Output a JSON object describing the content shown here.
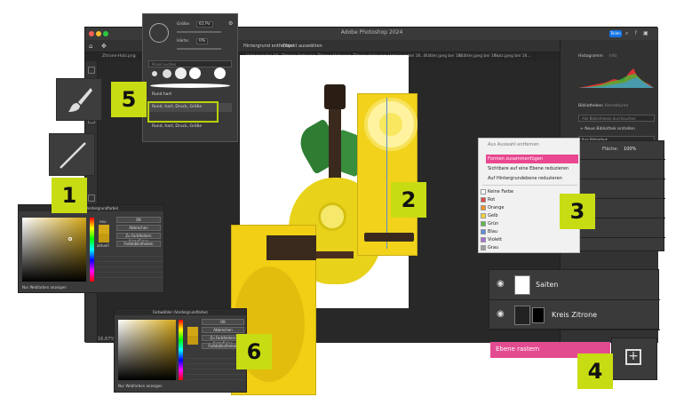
{
  "window": {
    "title": "Adobe Photoshop 2024",
    "share_label": "Teilen",
    "zoom": "16,67%"
  },
  "options_bar": {
    "remove_bg": "Hintergrund entfernen",
    "select_subject": "Objekt auswählen"
  },
  "tabs": [
    "Zitrone-Holz.png",
    "Holz.jpeg bei 16...",
    "Zitrone-Holz.png",
    "Zitrone-Holz.png",
    "Zitrone-Holz.png",
    "Holz.jpeg bei 16...",
    "Blätter.jpeg bei 16...",
    "Blätter.jpeg bei 16...",
    "Holz.jpeg bei 16..."
  ],
  "brush_popup": {
    "size_label": "Größe:",
    "size_value": "61 Px",
    "hardness_label": "Härte:",
    "hardness_value": "0%",
    "search_placeholder": "Pinsel suchen",
    "items": [
      "Rund hart",
      "Rund, hart, Druck, Größe",
      "Rund, hart, Druck, Größe"
    ]
  },
  "color_picker_1": {
    "title": "Farbwähler (Vordergrundfarbe)",
    "ok": "OK",
    "cancel": "Abbrechen",
    "add_swatch": "Zu Farbfeldern hinzufügen",
    "libraries": "Farbbibliotheken",
    "web_only": "Nur Webfarben anzeigen",
    "new_label": "neu",
    "current_label": "aktuell"
  },
  "color_picker_2": {
    "title": "Farbwähler (Vordergrundfarbe)",
    "ok": "OK",
    "cancel": "Abbrechen",
    "add_swatch": "Zu Farbfeldern hinzufügen",
    "libraries": "Farbbibliotheken",
    "web_only": "Nur Webfarben anzeigen"
  },
  "context_menu": {
    "items": [
      {
        "label": "Aus Auswahl entfernen",
        "state": "muted"
      },
      {
        "label": "Formen zusammenfügen",
        "state": "highlighted"
      },
      {
        "label": "Sichtbare auf eine Ebene reduzieren",
        "state": "normal"
      },
      {
        "label": "Auf Hintergrundebene reduzieren",
        "state": "normal"
      }
    ],
    "colors": [
      {
        "label": "Keine Farbe",
        "color": "#ffffff"
      },
      {
        "label": "Rot",
        "color": "#e04848"
      },
      {
        "label": "Orange",
        "color": "#f0922b"
      },
      {
        "label": "Gelb",
        "color": "#f0d434"
      },
      {
        "label": "Grün",
        "color": "#5fb84e"
      },
      {
        "label": "Blau",
        "color": "#5a8de0"
      },
      {
        "label": "Violett",
        "color": "#a56fd0"
      },
      {
        "label": "Grau",
        "color": "#a0a0a0"
      }
    ]
  },
  "layers": {
    "opacity_label": "Fläche:",
    "opacity_value": "100%",
    "rows": [
      {
        "name": "Saiten"
      },
      {
        "name": "Kreis Zitrone"
      }
    ],
    "rasterize": "Ebene rastern"
  },
  "panels": {
    "histogram": "Histogramm",
    "info": "Info",
    "libraries": "Bibliotheken",
    "adjustments": "Korrekturen",
    "search_libraries": "Alle Bibliotheken durchsuchen",
    "new_library": "+ Neue Bibliothek erstellen",
    "my_library": "Ihre Bibliothek"
  },
  "badges": [
    "1",
    "2",
    "3",
    "4",
    "5",
    "6"
  ],
  "accent": {
    "badge": "#c8dc14",
    "highlight": "#e94791",
    "share": "#1473e6"
  }
}
